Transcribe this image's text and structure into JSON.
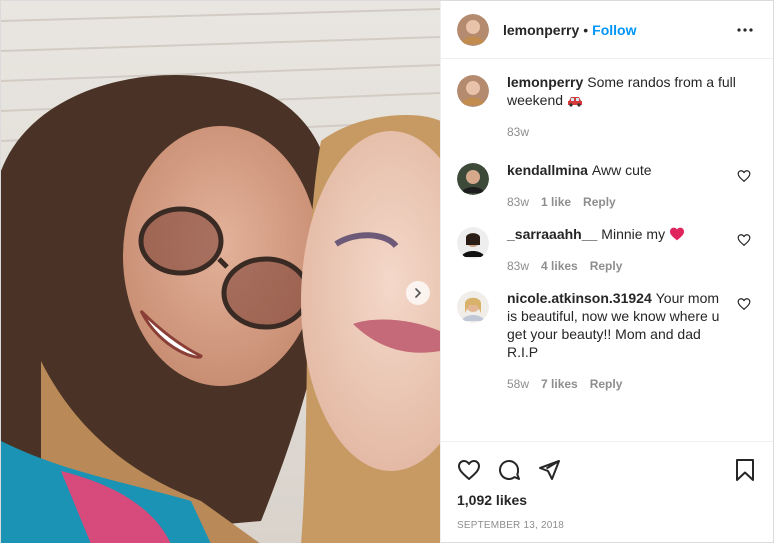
{
  "post": {
    "photo_alt": "",
    "author": {
      "username": "lemonperry",
      "follow_label": "Follow",
      "separator": "•"
    },
    "caption": {
      "username": "lemonperry",
      "text": "Some randos from a full weekend",
      "emoji": "red-car-emoji",
      "time": "83w"
    },
    "comments": [
      {
        "username": "kendallmina",
        "text": "Aww cute",
        "time": "83w",
        "likes": "1 like",
        "reply": "Reply"
      },
      {
        "username": "_sarraaahh__",
        "text": "Minnie my",
        "emoji": "red-heart-emoji",
        "time": "83w",
        "likes": "4 likes",
        "reply": "Reply"
      },
      {
        "username": "nicole.atkinson.31924",
        "text": "Your mom is beautiful, now we know where u get your beauty!! Mom and dad R.I.P",
        "time": "58w",
        "likes": "7 likes",
        "reply": "Reply"
      }
    ],
    "likes_count": "1,092 likes",
    "date": "SEPTEMBER 13, 2018",
    "icons": {
      "like": "heart-icon",
      "comment": "comment-icon",
      "share": "share-icon",
      "save": "bookmark-icon",
      "more": "more-icon",
      "next": "chevron-right-icon"
    },
    "colors": {
      "follow": "#0095f6",
      "muted": "#8e8e8e",
      "heart": "#ed4956"
    }
  }
}
